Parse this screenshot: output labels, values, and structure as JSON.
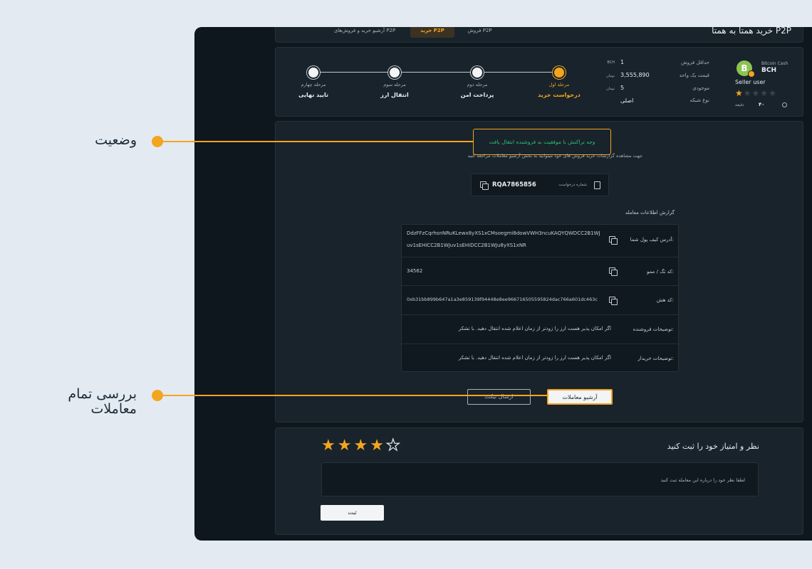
{
  "header": {
    "title": "خرید همتا به همتا P2P",
    "tabs": {
      "buy": "خرید P2P",
      "sell": "فروش P2P",
      "archive": "آرشیو خرید و فروش‌های P2P"
    }
  },
  "coin": {
    "name": "Bitcoin Cash",
    "ticker": "BCH",
    "logo_glyph": "B",
    "seller": "Seller user",
    "rating": 1,
    "rating_max": 5,
    "timer_value": "۴۰",
    "timer_unit": "دقیقه"
  },
  "info": [
    {
      "label": "حداقل فروش",
      "value": "1",
      "unit": "BCH"
    },
    {
      "label": "قیمت یک واحد",
      "value": "3,555,890",
      "unit": "تومان"
    },
    {
      "label": "موجودی",
      "value": "5",
      "unit": "تومان"
    },
    {
      "label": "نوع شبکه",
      "value": "اصلی",
      "unit": ""
    }
  ],
  "steps": [
    {
      "sub": "مرحله اول",
      "label": "درخواست خرید",
      "active": true
    },
    {
      "sub": "مرحله دوم",
      "label": "پرداخت امن",
      "active": false
    },
    {
      "sub": "مرحله سوم",
      "label": "انتقال ارز",
      "active": false
    },
    {
      "sub": "مرحله چهارم",
      "label": "تایید نهایی",
      "active": false
    }
  ],
  "status": {
    "message": "وجه تراکنش با موفقیت به فروشنده انتقال یافت",
    "note": "جهت مشاهده گزارشات خرید فروش های خود میتوانید به بخش آرشیو معاملات مراجعه کنید"
  },
  "request": {
    "label": "شماره درخواست",
    "value": "RQA7865856"
  },
  "report": {
    "title": "گزارش اطلاعات معامله",
    "rows": [
      {
        "label": "آدرس کیف پول شما:",
        "value": "DdzFFzCqrhsnNRuKLewx8yXS1xCMsoegmi8dowVWH3ncuKAQYQWDCC2B1WJuv1sEHiCC2B1WJuv1sEHiDCC2B1WJu8yXS1xNR",
        "copy": true
      },
      {
        "label": "کد تگ / ممو:",
        "value": "34562",
        "copy": true
      },
      {
        "label": "کد هش:",
        "value": "0xb31bb899b647a1a3e859139f94448e8ee966716505595824dac766a601dc463c",
        "copy": true
      },
      {
        "label": "توضیحات فروشنده:",
        "value": "اگر امکان پذیر هست ارز را زودتر از زمان اعلام شده انتقال دهید. با تشکر",
        "copy": false
      },
      {
        "label": "توضیحات خریدار:",
        "value": "اگر امکان پذیر هست ارز را زودتر از زمان اعلام شده انتقال دهید. با تشکر",
        "copy": false
      }
    ]
  },
  "buttons": {
    "archive": "آرشیو معاملات",
    "ticket": "ارسال تیکت"
  },
  "review": {
    "title": "نظر و امتیاز خود را ثبت کنید",
    "rating": 4,
    "rating_max": 5,
    "placeholder": "لطفا نظر خود را درباره این معامله ثبت کنید",
    "submit": "ثبت"
  },
  "annotations": {
    "status_label": "وضعیت",
    "archive_label_line1": "بررسی تمام",
    "archive_label_line2": "معاملات"
  },
  "colors": {
    "accent": "#f4a51f",
    "success": "#2fbf71",
    "frame_bg": "#0d171d",
    "panel_bg": "#19232b",
    "page_bg": "#e3eaf2"
  }
}
